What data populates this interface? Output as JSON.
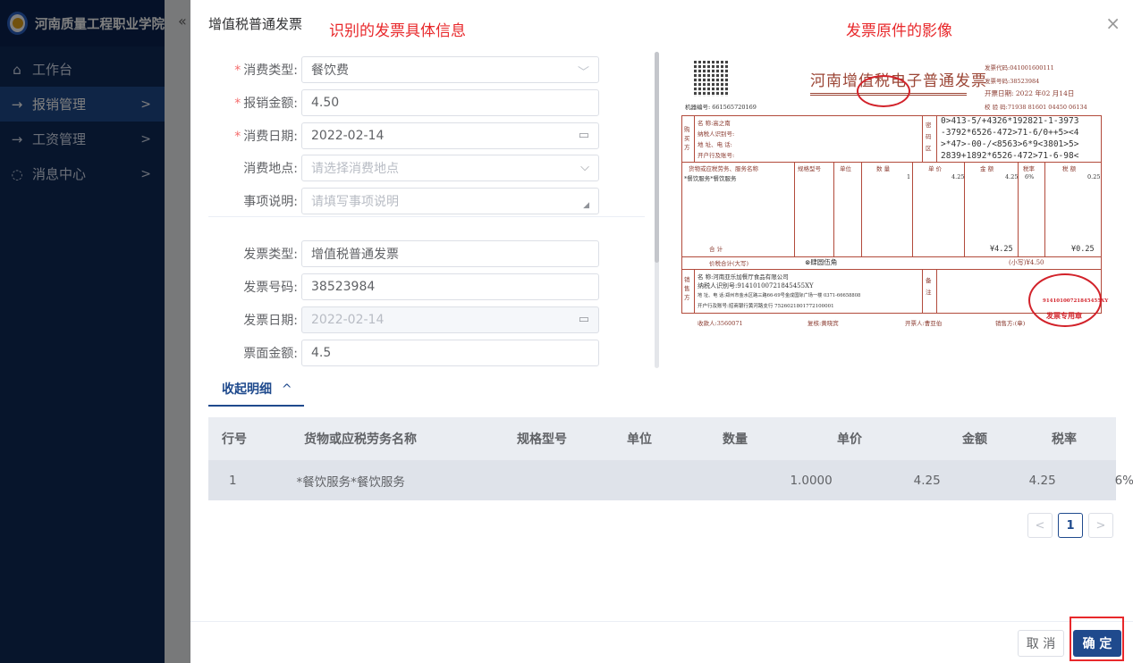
{
  "sidebar": {
    "logo": "school-logo",
    "title": "河南质量工程职业学院",
    "items": [
      {
        "icon": "⌂",
        "label": "工作台",
        "arrow": ""
      },
      {
        "icon": "→",
        "label": "报销管理",
        "arrow": ">"
      },
      {
        "icon": "→",
        "label": "工资管理",
        "arrow": ">"
      },
      {
        "icon": "◌",
        "label": "消息中心",
        "arrow": ">"
      }
    ],
    "collapse_icon": "«"
  },
  "dialog": {
    "title": "增值税普通发票",
    "annotation_left": "识别的发票具体信息",
    "annotation_right": "发票原件的影像",
    "close_icon": "×"
  },
  "form": {
    "consume_type": {
      "label": "消费类型:",
      "value": "餐饮费"
    },
    "amount": {
      "label": "报销金额:",
      "value": "4.50"
    },
    "consume_date": {
      "label": "消费日期:",
      "value": "2022-02-14"
    },
    "place": {
      "label": "消费地点:",
      "placeholder": "请选择消费地点"
    },
    "desc": {
      "label": "事项说明:",
      "placeholder": "请填写事项说明"
    },
    "invoice_type": {
      "label": "发票类型:",
      "value": "增值税普通发票"
    },
    "invoice_no": {
      "label": "发票号码:",
      "value": "38523984"
    },
    "invoice_date": {
      "label": "发票日期:",
      "value": "2022-02-14"
    },
    "face_amount": {
      "label": "票面金额:",
      "value": "4.5"
    }
  },
  "invoice_image": {
    "title": "河南增值税电子普通发票",
    "code": "发票代码:041001600111",
    "number": "发票号码:38523984",
    "date": "开票日期: 2022 年02 月14日",
    "check": "校 验 码:71938 81601 04450 06134",
    "machine": "机器编号: 661565720169",
    "buyer_name": "名        称:高之南",
    "buyer_tax": "纳税人识别号:",
    "buyer_addr": "地  址、电  话:",
    "buyer_bank": "开户行及账号:",
    "cipher": [
      "0>413-5/+4326*192821-1-3973",
      "-3792*6526-472>71-6/0++5><4",
      ">*47>-00-/<8563>6*9<3801>5>",
      "2839+1892*6526-472>71-6-98<"
    ],
    "col_headers": [
      "货物或应税劳务、服务名称",
      "规格型号",
      "单位",
      "数  量",
      "单 价",
      "金  额",
      "税率",
      "税  额"
    ],
    "item_name": "*餐饮服务*餐饮服务",
    "item_qty": "1",
    "item_price": "4.25",
    "item_amount": "4.25",
    "item_rate": "6%",
    "item_tax": "0.25",
    "total_label": "合        计",
    "total_amount": "¥4.25",
    "total_tax": "¥0.25",
    "grand_label": "价税合计(大写)",
    "grand_cn": "⊗肆圆伍角",
    "grand_small": "(小写)¥4.50",
    "seller_name": "名       称:河南亚乐加餐厅食品有限公司",
    "seller_tax": "纳税人识别号:91410100721845455XY",
    "seller_addr": "地  址、电  话:郑州市金水区路三路66-69号金成国际广场一楼 0371-66658808",
    "seller_bank": "开户行及账号:招商银行黄河路支行 7526021801772100001",
    "payee": "收款人:3560071",
    "reviewer": "复核:黄晓宾",
    "drawer": "开票人:曹亚伯",
    "seller_sign": "销售方:(章)",
    "stamp_text": "91410100721845455XY",
    "stamp_label": "发票专用章",
    "buyer_side": "购买方",
    "seller_side": "销售方",
    "cipher_side": "密码区",
    "note_side": "备注"
  },
  "detail_toggle": {
    "label": "收起明细",
    "icon": "^"
  },
  "table": {
    "headers": [
      "行号",
      "货物或应税劳务名称",
      "规格型号",
      "单位",
      "数量",
      "单价",
      "金额",
      "税率"
    ],
    "rows": [
      {
        "no": "1",
        "name": "*餐饮服务*餐饮服务",
        "spec": "",
        "unit": "",
        "qty": "1.0000",
        "price": "4.25",
        "amount": "4.25",
        "rate": "6%"
      }
    ]
  },
  "pagination": {
    "prev": "<",
    "page": "1",
    "next": ">"
  },
  "footer": {
    "cancel": "取 消",
    "ok": "确 定"
  },
  "colors": {
    "primary": "#1f4a8d",
    "annotation": "#e8282b",
    "sidebar": "#0e2a59"
  }
}
